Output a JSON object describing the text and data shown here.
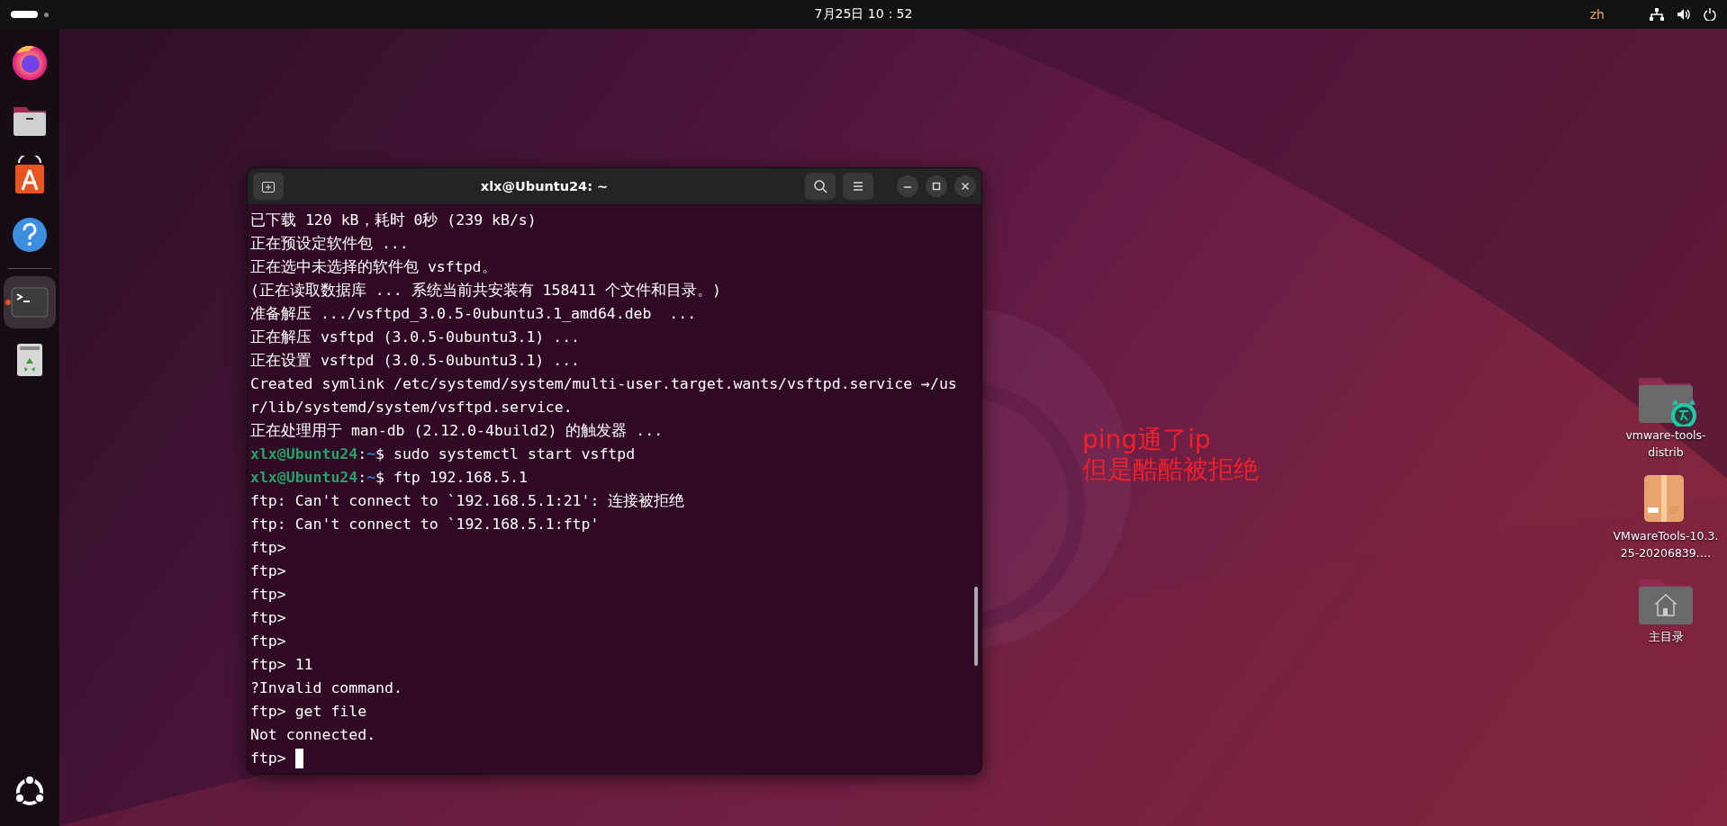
{
  "top_bar": {
    "clock": "7月25日 10：52",
    "language": "zh"
  },
  "dock": {
    "items": [
      {
        "kind": "firefox",
        "running": false
      },
      {
        "kind": "files",
        "running": false
      },
      {
        "kind": "store",
        "running": false
      },
      {
        "kind": "help",
        "running": false
      },
      {
        "kind": "terminal",
        "running": true
      },
      {
        "kind": "trash",
        "running": false
      }
    ]
  },
  "terminal": {
    "title": "xlx@Ubuntu24: ~",
    "lines": [
      {
        "kind": "output",
        "text": "已下载 120 kB，耗时 0秒 (239 kB/s)"
      },
      {
        "kind": "output",
        "text": "正在预设定软件包 ..."
      },
      {
        "kind": "output",
        "text": "正在选中未选择的软件包 vsftpd。"
      },
      {
        "kind": "output",
        "text": "(正在读取数据库 ... 系统当前共安装有 158411 个文件和目录。)"
      },
      {
        "kind": "output",
        "text": "准备解压 .../vsftpd_3.0.5-0ubuntu3.1_amd64.deb  ..."
      },
      {
        "kind": "output",
        "text": "正在解压 vsftpd (3.0.5-0ubuntu3.1) ..."
      },
      {
        "kind": "output",
        "text": "正在设置 vsftpd (3.0.5-0ubuntu3.1) ..."
      },
      {
        "kind": "output",
        "text": "Created symlink /etc/systemd/system/multi-user.target.wants/vsftpd.service →/us"
      },
      {
        "kind": "output",
        "text": "r/lib/systemd/system/vsftpd.service."
      },
      {
        "kind": "output",
        "text": "正在处理用于 man-db (2.12.0-4build2) 的触发器 ..."
      },
      {
        "kind": "prompt",
        "user": "xlx@Ubuntu24",
        "sep": ":",
        "path": "~",
        "symbol": "$",
        "command": "sudo systemctl start vsftpd"
      },
      {
        "kind": "prompt",
        "user": "xlx@Ubuntu24",
        "sep": ":",
        "path": "~",
        "symbol": "$",
        "command": "ftp 192.168.5.1"
      },
      {
        "kind": "output",
        "text": "ftp: Can't connect to `192.168.5.1:21': 连接被拒绝"
      },
      {
        "kind": "output",
        "text": "ftp: Can't connect to `192.168.5.1:ftp'"
      },
      {
        "kind": "output",
        "text": "ftp>"
      },
      {
        "kind": "output",
        "text": "ftp>"
      },
      {
        "kind": "output",
        "text": "ftp>"
      },
      {
        "kind": "output",
        "text": "ftp>"
      },
      {
        "kind": "output",
        "text": "ftp>"
      },
      {
        "kind": "output",
        "text": "ftp> 11"
      },
      {
        "kind": "output",
        "text": "?Invalid command."
      },
      {
        "kind": "output",
        "text": "ftp> get file"
      },
      {
        "kind": "output",
        "text": "Not connected."
      },
      {
        "kind": "input",
        "text": "ftp>"
      }
    ]
  },
  "note": {
    "lines": [
      "ping通了ip",
      "但是酷酷被拒绝"
    ]
  },
  "desktop_icons": [
    {
      "kind": "folder-badge",
      "label": "vmware-tools-distrib"
    },
    {
      "kind": "package",
      "label": "VMwareTools-10.3.25-20206839.…"
    },
    {
      "kind": "home",
      "label": "主目录"
    }
  ]
}
